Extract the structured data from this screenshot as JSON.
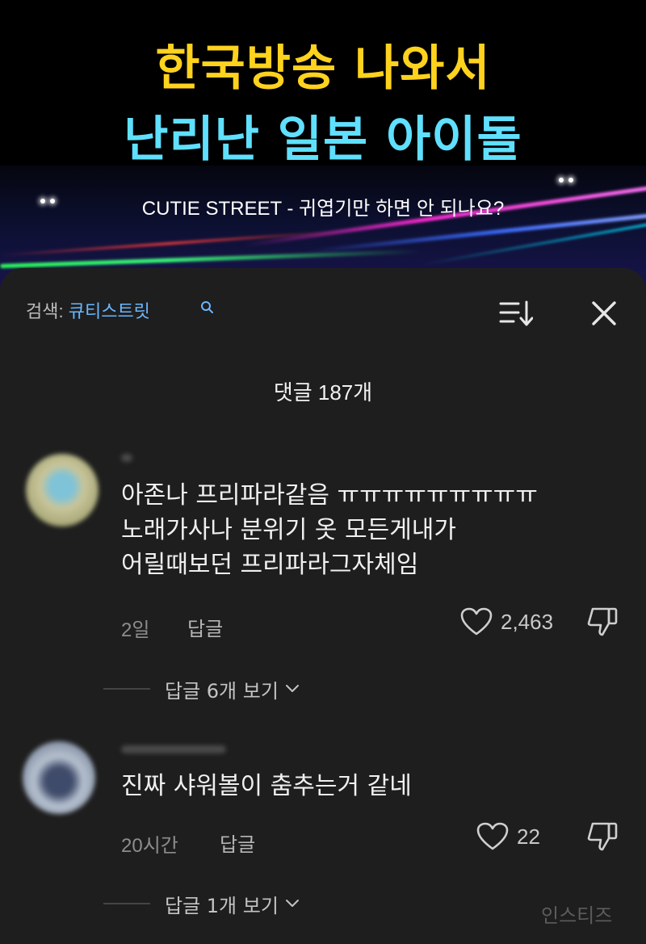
{
  "video": {
    "headline_line1": "한국방송 나와서",
    "headline_line2": "난리난 일본 아이돌",
    "subtitle": "CUTIE STREET - 귀엽기만 하면 안 되나요?",
    "headline_colors": {
      "line1": "#ffd21e",
      "line2": "#5fe0ff"
    }
  },
  "header": {
    "search_prefix": "검색: ",
    "search_query": "큐티스트릿",
    "search_icon": "search-icon",
    "sort_icon": "sort-icon",
    "close_icon": "close-icon",
    "comment_count_label": "댓글 187개"
  },
  "comments": [
    {
      "text_lines": [
        "아존나 프리파라같음 ㅠㅠㅠㅠㅠㅠㅠㅠㅠ",
        "노래가사나 분위기 옷 모든게내가",
        "어릴때보던 프리파라그자체임"
      ],
      "time": "2일",
      "reply_label": "답글",
      "likes": "2,463",
      "view_replies_label": "답글 6개 보기"
    },
    {
      "text_lines": [
        "진짜 샤워볼이 춤추는거 같네"
      ],
      "time": "20시간",
      "reply_label": "답글",
      "likes": "22",
      "view_replies_label": "답글 1개 보기"
    }
  ],
  "watermark": "인스티즈",
  "colors": {
    "sheet_background": "#1e1e1e",
    "search_query": "#6ab7ff"
  }
}
